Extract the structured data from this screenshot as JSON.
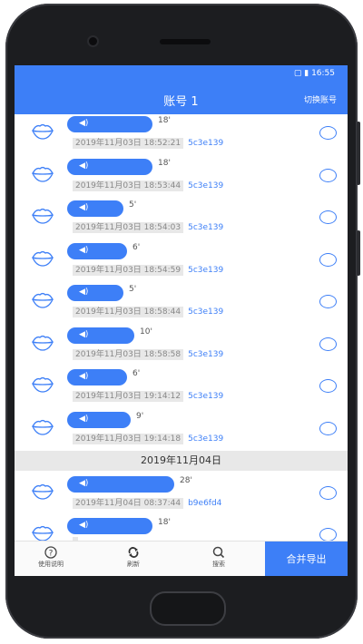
{
  "status": {
    "time": "16:55"
  },
  "header": {
    "title": "账号 1",
    "switch_label": "切换账号"
  },
  "messages_day1": [
    {
      "duration": "18'",
      "time": "2019年11月03日 18:52:21",
      "code": "5c3e139"
    },
    {
      "duration": "18'",
      "time": "2019年11月03日 18:53:44",
      "code": "5c3e139"
    },
    {
      "duration": "5'",
      "time": "2019年11月03日 18:54:03",
      "code": "5c3e139"
    },
    {
      "duration": "6'",
      "time": "2019年11月03日 18:54:59",
      "code": "5c3e139"
    },
    {
      "duration": "5'",
      "time": "2019年11月03日 18:58:44",
      "code": "5c3e139"
    },
    {
      "duration": "10'",
      "time": "2019年11月03日 18:58:58",
      "code": "5c3e139"
    },
    {
      "duration": "6'",
      "time": "2019年11月03日 19:14:12",
      "code": "5c3e139"
    },
    {
      "duration": "9'",
      "time": "2019年11月03日 19:14:18",
      "code": "5c3e139"
    }
  ],
  "date_separator": "2019年11月04日",
  "messages_day2": [
    {
      "duration": "28'",
      "time": "2019年11月04日 08:37:44",
      "code": "b9e6fd4"
    },
    {
      "duration": "18'",
      "time": "",
      "code": ""
    }
  ],
  "bottom": {
    "tabs": [
      {
        "icon": "help-icon",
        "label": "使用说明"
      },
      {
        "icon": "refresh-icon",
        "label": "刷新"
      },
      {
        "icon": "search-icon",
        "label": "搜索"
      }
    ],
    "merge_label": "合并导出"
  },
  "colors": {
    "accent": "#3d7ff7",
    "separator_bg": "#e8e8e8"
  }
}
